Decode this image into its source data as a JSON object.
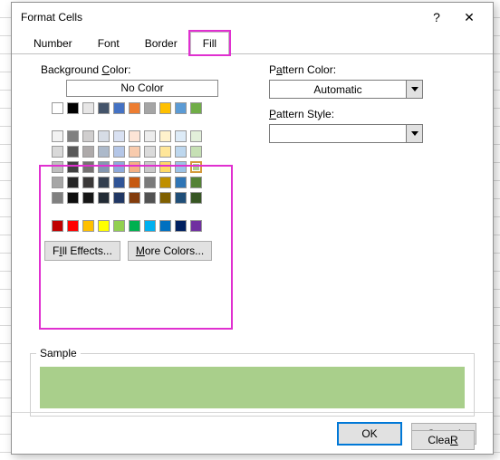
{
  "window": {
    "title": "Format Cells",
    "help_tip": "?",
    "close_tip": "✕"
  },
  "tabs": {
    "number": "Number",
    "font": "Font",
    "border": "Border",
    "fill": "Fill"
  },
  "bg_label_pre": "Background ",
  "bg_label_u": "C",
  "bg_label_post": "olor:",
  "nocolor_label": "No Color",
  "fill_effects_u": "I",
  "fill_effects_pre": "F",
  "fill_effects_post": "ll Effects...",
  "more_colors_u": "M",
  "more_colors_post": "ore Colors...",
  "pattern_color_label_pre": "P",
  "pattern_color_label_u": "a",
  "pattern_color_label_post": "ttern Color:",
  "pattern_color_value": "Automatic",
  "pattern_style_label_pre": "",
  "pattern_style_label_u": "P",
  "pattern_style_label_post": "attern Style:",
  "pattern_style_value": "",
  "sample_label": "Sample",
  "clear_label_u": "R",
  "clear_label_pre": "Clea",
  "clear_label_post": "",
  "ok_label": "OK",
  "cancel_label": "Cancel",
  "theme_row1": [
    "#ffffff",
    "#000000",
    "#e7e6e6",
    "#44546a",
    "#4472c4",
    "#ed7d31",
    "#a5a5a5",
    "#ffc000",
    "#5b9bd5",
    "#70ad47"
  ],
  "theme_shades": [
    [
      "#f2f2f2",
      "#808080",
      "#d0cece",
      "#d6dce5",
      "#d9e1f2",
      "#fce4d6",
      "#ededed",
      "#fff2cc",
      "#ddebf7",
      "#e2efda"
    ],
    [
      "#d9d9d9",
      "#595959",
      "#aeaaaa",
      "#acb9ca",
      "#b4c6e7",
      "#f8cbad",
      "#dbdbdb",
      "#ffe699",
      "#bdd7ee",
      "#c6e0b4"
    ],
    [
      "#bfbfbf",
      "#404040",
      "#757171",
      "#8497b0",
      "#8ea9db",
      "#f4b084",
      "#c9c9c9",
      "#ffd966",
      "#9bc2e6",
      "#a9d08e"
    ],
    [
      "#a6a6a6",
      "#262626",
      "#3a3838",
      "#333f4f",
      "#305496",
      "#c65911",
      "#7b7b7b",
      "#bf8f00",
      "#2f75b5",
      "#548235"
    ],
    [
      "#808080",
      "#0d0d0d",
      "#161616",
      "#222b35",
      "#203764",
      "#833c0c",
      "#525252",
      "#806000",
      "#1f4e78",
      "#375623"
    ]
  ],
  "standard_colors": [
    "#c00000",
    "#ff0000",
    "#ffc000",
    "#ffff00",
    "#92d050",
    "#00b050",
    "#00b0f0",
    "#0070c0",
    "#002060",
    "#7030a0"
  ],
  "selected_color": "#a9d08e",
  "sample_color": "#a9cf8b"
}
